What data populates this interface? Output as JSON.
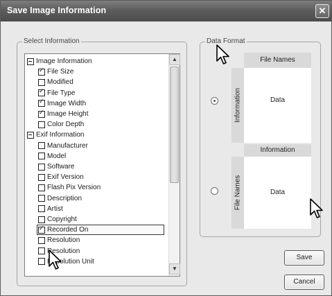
{
  "window": {
    "title": "Save Image Information",
    "close_glyph": "✕"
  },
  "select_information": {
    "label": "Select Information",
    "items": [
      {
        "label": "Image Information",
        "state": "minus",
        "level": 0
      },
      {
        "label": "File Size",
        "state": "checked",
        "level": 1
      },
      {
        "label": "Modified",
        "state": "unchecked",
        "level": 1
      },
      {
        "label": "File Type",
        "state": "checked",
        "level": 1
      },
      {
        "label": "Image Width",
        "state": "checked",
        "level": 1
      },
      {
        "label": "Image Height",
        "state": "checked",
        "level": 1
      },
      {
        "label": "Color Depth",
        "state": "unchecked",
        "level": 1
      },
      {
        "label": "Exif Information",
        "state": "minus",
        "level": 0
      },
      {
        "label": "Manufacturer",
        "state": "unchecked",
        "level": 1
      },
      {
        "label": "Model",
        "state": "unchecked",
        "level": 1
      },
      {
        "label": "Software",
        "state": "unchecked",
        "level": 1
      },
      {
        "label": "Exif Version",
        "state": "unchecked",
        "level": 1
      },
      {
        "label": "Flash Pix Version",
        "state": "unchecked",
        "level": 1
      },
      {
        "label": "Description",
        "state": "unchecked",
        "level": 1
      },
      {
        "label": "Artist",
        "state": "unchecked",
        "level": 1
      },
      {
        "label": "Copyright",
        "state": "unchecked",
        "level": 1
      },
      {
        "label": "Recorded On",
        "state": "checked",
        "level": 1,
        "highlight": true
      },
      {
        "label": "Resolution",
        "state": "unchecked",
        "level": 1
      },
      {
        "label": "Resolution",
        "state": "unchecked",
        "level": 1
      },
      {
        "label": "Resolution Unit",
        "state": "unchecked",
        "level": 1
      }
    ],
    "scroll_up": "▲",
    "scroll_down": "▼"
  },
  "data_format": {
    "label": "Data Format",
    "option_a": {
      "header": "File Names",
      "side": "Information",
      "data": "Data",
      "selected": true
    },
    "option_b": {
      "header": "Information",
      "side": "File Names",
      "data": "Data",
      "selected": false
    }
  },
  "buttons": {
    "save": "Save",
    "cancel": "Cancel"
  },
  "icons": [
    "close-icon",
    "arrow-cursor-icon",
    "scroll-up-arrow-icon",
    "scroll-down-arrow-icon"
  ],
  "colors": {
    "titlebar": "#5d5d5d",
    "dialog_background": "#e9e9e9",
    "preview_header": "#d9d9d9"
  }
}
